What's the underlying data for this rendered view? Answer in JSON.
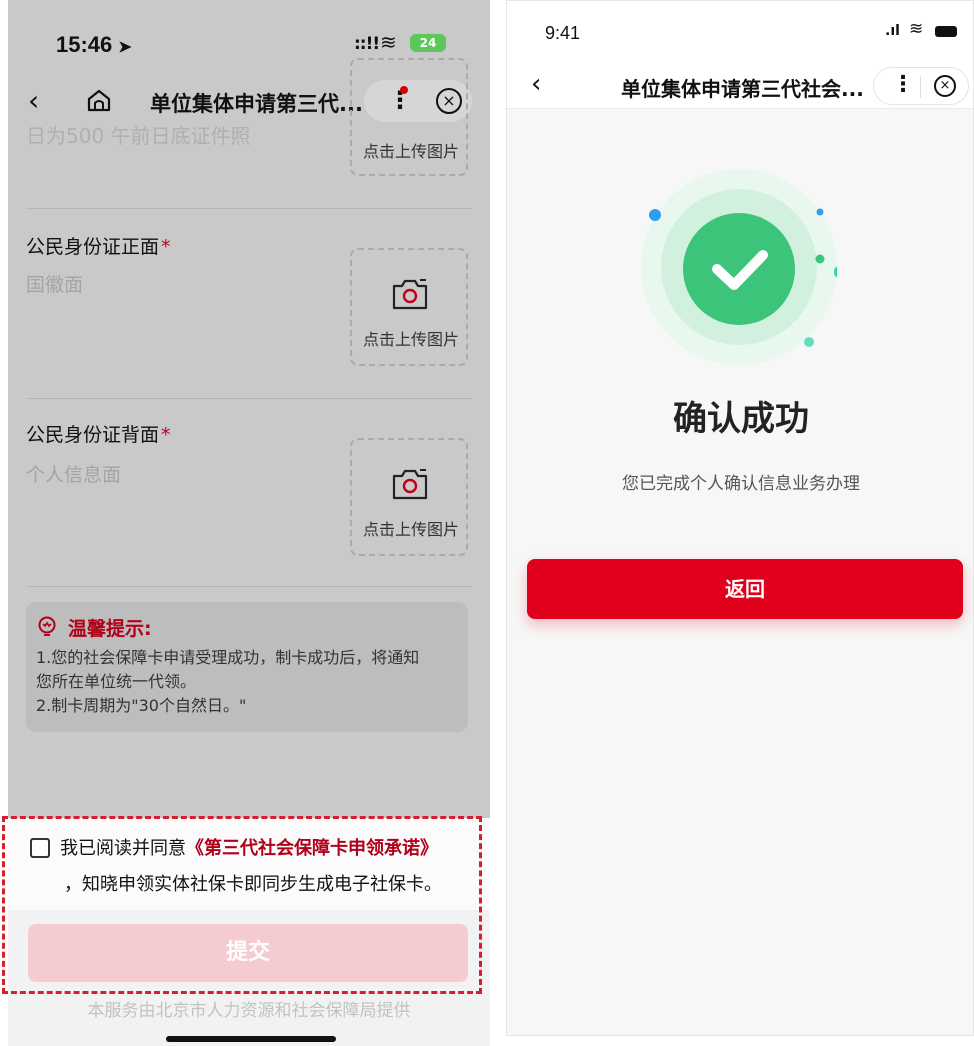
{
  "left_screen": {
    "status": {
      "time": "15:46",
      "signal": "::!!",
      "battery": "24"
    },
    "nav": {
      "back_glyph": "‹",
      "title": "单位集体申请第三代...",
      "close_glyph": "×"
    },
    "cut_text": "日为500 午前日底证件照",
    "upload_label": "点击上传图片",
    "fields": [
      {
        "label": "公民身份证正面",
        "required": "*",
        "hint": "国徽面"
      },
      {
        "label": "公民身份证背面",
        "required": "*",
        "hint": "个人信息面"
      }
    ],
    "tips": {
      "title": "温馨提示:",
      "line1": "1.您的社会保障卡申请受理成功，制卡成功后，将通知",
      "line2": "您所在单位统一代领。",
      "line3": "2.制卡周期为\"30个自然日。\""
    },
    "agreement": {
      "prefix": "我已阅读并同意",
      "link": "《第三代社会保障卡申领承诺》",
      "suffix": "，知晓申领实体社保卡即同步生成电子社保卡。"
    },
    "submit_label": "提交",
    "footer": "本服务由北京市人力资源和社会保障局提供"
  },
  "right_screen": {
    "status": {
      "time": "9:41"
    },
    "nav": {
      "back_glyph": "‹",
      "title": "单位集体申请第三代社会...",
      "close_glyph": "×"
    },
    "heading": "确认成功",
    "subtext": "您已完成个人确认信息业务办理",
    "return_label": "返回"
  },
  "colors": {
    "brand_red": "#e0001b",
    "success_green": "#3cc57a",
    "dim_bg": "#c9c9c9"
  }
}
